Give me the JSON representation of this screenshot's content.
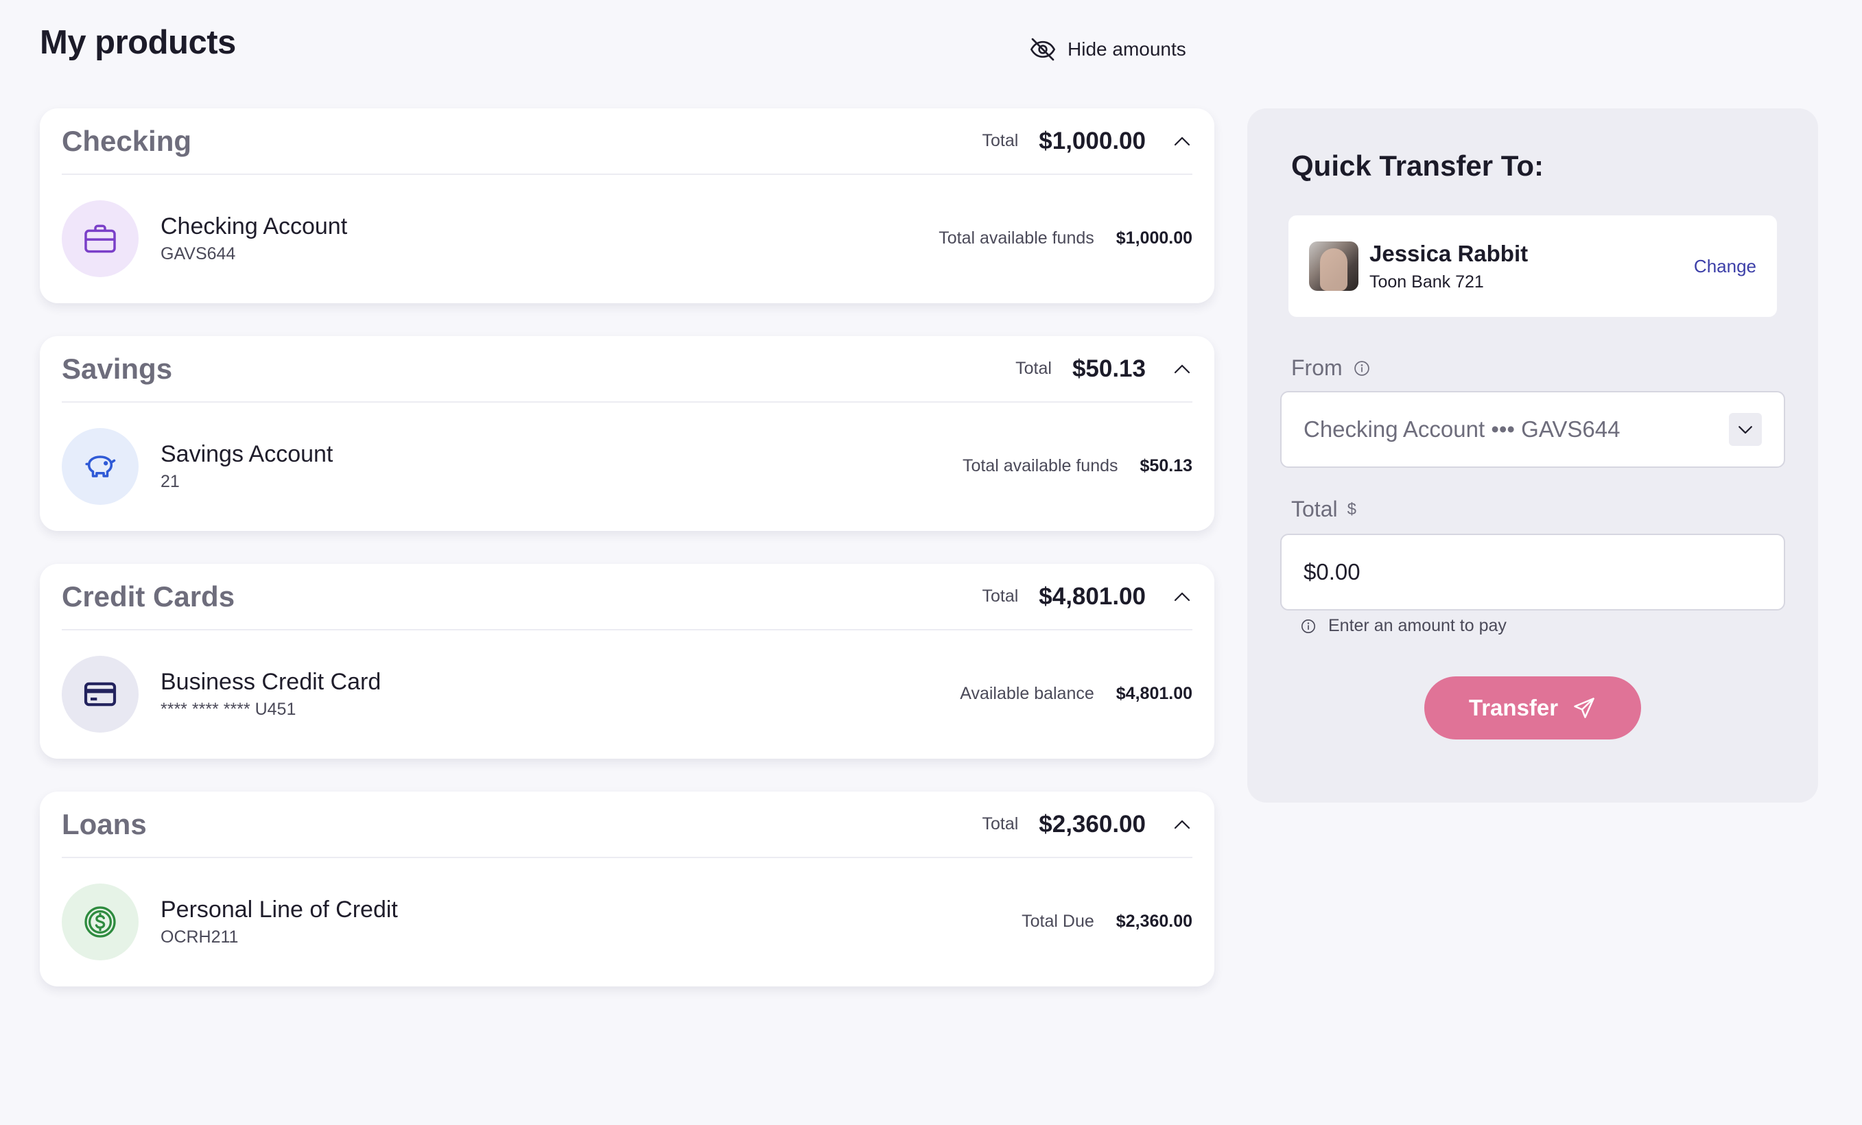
{
  "page": {
    "title": "My products"
  },
  "toolbar": {
    "hide_amounts_label": "Hide amounts"
  },
  "groups": [
    {
      "title": "Checking",
      "total_label": "Total",
      "total": "$1,000.00",
      "account": {
        "name": "Checking Account",
        "id": "GAVS644",
        "label": "Total available funds",
        "value": "$1,000.00",
        "icon": "briefcase-icon",
        "icon_color": "#7a3fc8",
        "icon_bg": "#f0e6fa"
      }
    },
    {
      "title": "Savings",
      "total_label": "Total",
      "total": "$50.13",
      "account": {
        "name": "Savings Account",
        "id": "21",
        "label": "Total available funds",
        "value": "$50.13",
        "icon": "piggy-bank-icon",
        "icon_color": "#2f5ad6",
        "icon_bg": "#e6edfb"
      }
    },
    {
      "title": "Credit Cards",
      "total_label": "Total",
      "total": "$4,801.00",
      "account": {
        "name": "Business Credit Card",
        "id": "**** **** **** U451",
        "label": "Available balance",
        "value": "$4,801.00",
        "icon": "credit-card-icon",
        "icon_color": "#23235e",
        "icon_bg": "#e8e8f2"
      }
    },
    {
      "title": "Loans",
      "total_label": "Total",
      "total": "$2,360.00",
      "account": {
        "name": "Personal Line of Credit",
        "id": "OCRH211",
        "label": "Total Due",
        "value": "$2,360.00",
        "icon": "dollar-coin-icon",
        "icon_color": "#2e8b3f",
        "icon_bg": "#e6f3e7"
      }
    }
  ],
  "quick_transfer": {
    "title": "Quick Transfer To:",
    "recipient": {
      "name": "Jessica Rabbit",
      "bank": "Toon Bank 721",
      "change_label": "Change"
    },
    "from_label": "From",
    "from_value": "Checking Account ••• GAVS644",
    "total_label": "Total",
    "currency_symbol": "$",
    "amount_value": "$0.00",
    "hint": "Enter an amount to pay",
    "transfer_label": "Transfer"
  },
  "colors": {
    "accent": "#e07397",
    "link": "#3c3fa8",
    "background": "#f7f7fb",
    "panel": "#ededf3"
  }
}
